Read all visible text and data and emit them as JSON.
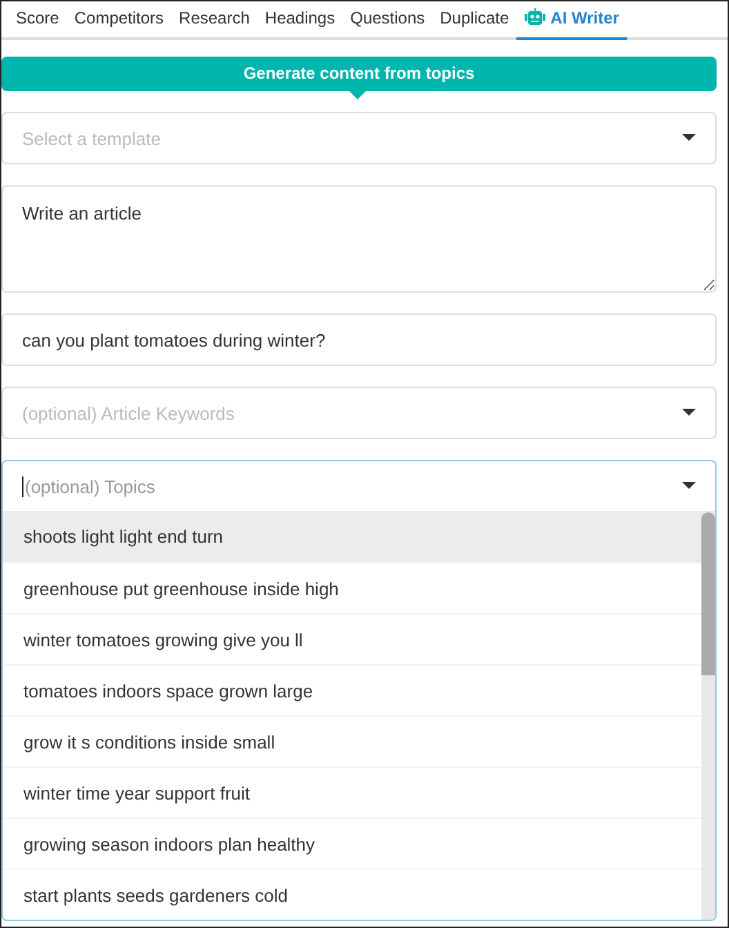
{
  "tabs": [
    {
      "label": "Score",
      "selected": false,
      "kind": "text"
    },
    {
      "label": "Competitors",
      "selected": false,
      "kind": "text"
    },
    {
      "label": "Research",
      "selected": false,
      "kind": "text"
    },
    {
      "label": "Headings",
      "selected": false,
      "kind": "text"
    },
    {
      "label": "Questions",
      "selected": false,
      "kind": "text"
    },
    {
      "label": "Duplicate",
      "selected": false,
      "kind": "text"
    },
    {
      "label": "AI Writer",
      "selected": true,
      "kind": "robot"
    }
  ],
  "banner": {
    "text": "Generate content from topics"
  },
  "fields": [
    {
      "kind": "select",
      "placeholder": "Select a template"
    },
    {
      "kind": "textarea",
      "value": "Write an article"
    },
    {
      "kind": "input",
      "value": "can you plant tomatoes during winter?"
    },
    {
      "kind": "select",
      "placeholder": "(optional) Article Keywords"
    }
  ],
  "topics": {
    "placeholder": "(optional) Topics",
    "options": [
      {
        "label": "shoots light light end turn",
        "highlighted": true
      },
      {
        "label": "greenhouse put greenhouse inside high",
        "highlighted": false
      },
      {
        "label": "winter tomatoes growing give you ll",
        "highlighted": false
      },
      {
        "label": "tomatoes indoors space grown large",
        "highlighted": false
      },
      {
        "label": "grow it s conditions inside small",
        "highlighted": false
      },
      {
        "label": "winter time year support fruit",
        "highlighted": false
      },
      {
        "label": "growing season indoors plan healthy",
        "highlighted": false
      },
      {
        "label": "start plants seeds gardeners cold",
        "highlighted": false
      }
    ]
  }
}
